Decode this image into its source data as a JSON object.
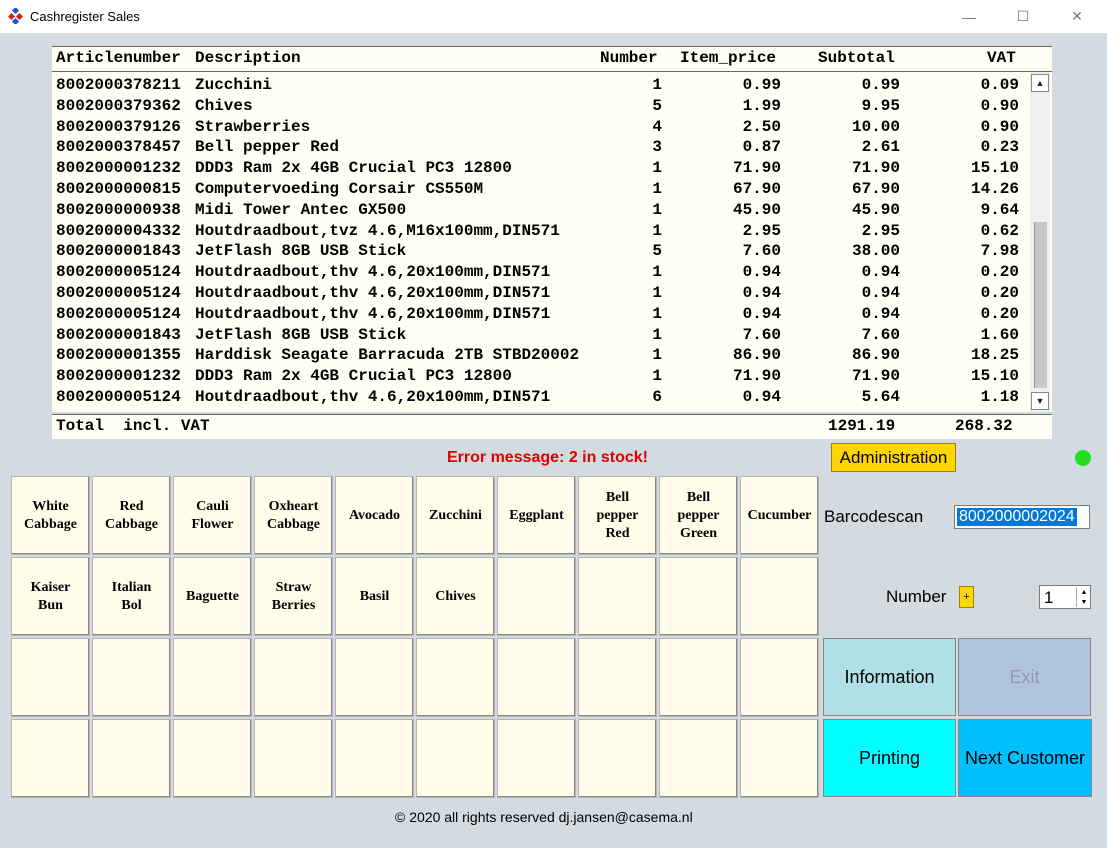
{
  "window": {
    "title": "Cashregister Sales",
    "min": "—",
    "max": "☐",
    "close": "✕"
  },
  "colors": {
    "accent_yellow": "#ffd700",
    "error": "#e00000",
    "status": "#22dd22"
  },
  "table": {
    "columns": {
      "article": "Articlenumber",
      "description": "Description",
      "number": "Number",
      "item_price": "Item_price",
      "subtotal": "Subtotal",
      "vat": "VAT"
    },
    "rows": [
      [
        "8002000378211",
        "Zucchini",
        "1",
        "0.99",
        "0.99",
        "0.09"
      ],
      [
        "8002000379362",
        "Chives",
        "5",
        "1.99",
        "9.95",
        "0.90"
      ],
      [
        "8002000379126",
        "Strawberries",
        "4",
        "2.50",
        "10.00",
        "0.90"
      ],
      [
        "8002000378457",
        "Bell pepper Red",
        "3",
        "0.87",
        "2.61",
        "0.23"
      ],
      [
        "8002000001232",
        "DDD3 Ram 2x 4GB Crucial PC3 12800",
        "1",
        "71.90",
        "71.90",
        "15.10"
      ],
      [
        "8002000000815",
        "Computervoeding Corsair CS550M",
        "1",
        "67.90",
        "67.90",
        "14.26"
      ],
      [
        "8002000000938",
        "Midi Tower Antec GX500",
        "1",
        "45.90",
        "45.90",
        "9.64"
      ],
      [
        "8002000004332",
        "Houtdraadbout,tvz 4.6,M16x100mm,DIN571",
        "1",
        "2.95",
        "2.95",
        "0.62"
      ],
      [
        "8002000001843",
        "JetFlash 8GB USB Stick",
        "5",
        "7.60",
        "38.00",
        "7.98"
      ],
      [
        "8002000005124",
        "Houtdraadbout,thv 4.6,20x100mm,DIN571",
        "1",
        "0.94",
        "0.94",
        "0.20"
      ],
      [
        "8002000005124",
        "Houtdraadbout,thv 4.6,20x100mm,DIN571",
        "1",
        "0.94",
        "0.94",
        "0.20"
      ],
      [
        "8002000005124",
        "Houtdraadbout,thv 4.6,20x100mm,DIN571",
        "1",
        "0.94",
        "0.94",
        "0.20"
      ],
      [
        "8002000001843",
        "JetFlash 8GB USB Stick",
        "1",
        "7.60",
        "7.60",
        "1.60"
      ],
      [
        "8002000001355",
        "Harddisk Seagate Barracuda 2TB STBD20002",
        "1",
        "86.90",
        "86.90",
        "18.25"
      ],
      [
        "8002000001232",
        "DDD3 Ram 2x 4GB Crucial PC3 12800",
        "1",
        "71.90",
        "71.90",
        "15.10"
      ],
      [
        "8002000005124",
        "Houtdraadbout,thv 4.6,20x100mm,DIN571",
        "6",
        "0.94",
        "5.64",
        "1.18"
      ]
    ],
    "total": {
      "label": "Total  incl. VAT",
      "subtotal": "1291.19",
      "vat": "268.32"
    },
    "scroll_up": "▲",
    "scroll_down": "▼"
  },
  "status": {
    "error_message": "Error message: 2 in stock!",
    "admin_label": "Administration"
  },
  "products": [
    [
      "White",
      "Cabbage"
    ],
    [
      "Red",
      "Cabbage"
    ],
    [
      "Cauli",
      "Flower"
    ],
    [
      "Oxheart",
      "Cabbage"
    ],
    [
      "Avocado"
    ],
    [
      "Zucchini"
    ],
    [
      "Eggplant"
    ],
    [
      "Bell",
      "pepper",
      "Red"
    ],
    [
      "Bell",
      "pepper",
      "Green"
    ],
    [
      "Cucumber"
    ],
    [
      "Kaiser",
      "Bun"
    ],
    [
      "Italian",
      "Bol"
    ],
    [
      "Baguette"
    ],
    [
      "Straw",
      "Berries"
    ],
    [
      "Basil"
    ],
    [
      "Chives"
    ],
    [],
    [],
    [],
    [],
    [],
    [],
    [],
    [],
    [],
    [],
    [],
    [],
    [],
    [],
    [],
    [],
    [],
    [],
    [],
    [],
    [],
    [],
    [],
    []
  ],
  "controls": {
    "barcode_label": "Barcodescan",
    "barcode_value": "8002000002024",
    "number_label": "Number",
    "plus": "+",
    "quantity": "1",
    "spin_up": "▲",
    "spin_down": "▼",
    "information": "Information",
    "exit": "Exit",
    "printing": "Printing",
    "next_customer": "Next Customer"
  },
  "footer": "© 2020 all rights reserved dj.jansen@casema.nl"
}
